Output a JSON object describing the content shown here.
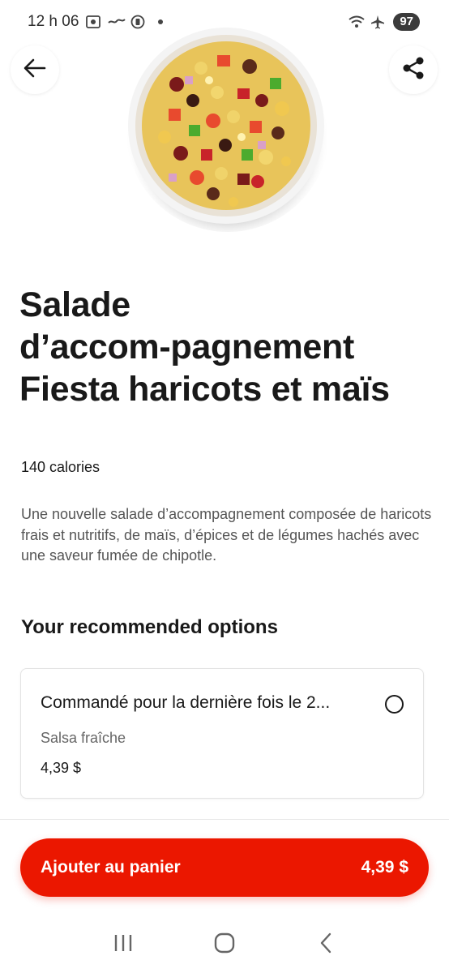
{
  "status_bar": {
    "time": "12 h 06",
    "battery": "97"
  },
  "product": {
    "title_lines": [
      "Salade",
      "d’accom-pagnement",
      "Fiesta haricots et maïs"
    ],
    "calories": "140 calories",
    "description": "Une nouvelle salade d’accompagnement composée de haricots frais et nutritifs, de maïs, d’épices et de légumes hachés avec une saveur fumée de chipotle."
  },
  "recommended": {
    "heading": "Your recommended options",
    "option": {
      "title": "Commandé pour la dernière fois le 2...",
      "subtitle": "Salsa fraîche",
      "price": "4,39 $"
    }
  },
  "cart_button": {
    "label": "Ajouter au panier",
    "price": "4,39 $"
  },
  "colors": {
    "accent": "#eb1700",
    "text": "#191919",
    "muted": "#555555"
  },
  "icons": {
    "back": "arrow-left-icon",
    "share": "share-icon",
    "nav_recent": "recent-apps-icon",
    "nav_home": "home-icon",
    "nav_back": "chevron-left-icon"
  }
}
